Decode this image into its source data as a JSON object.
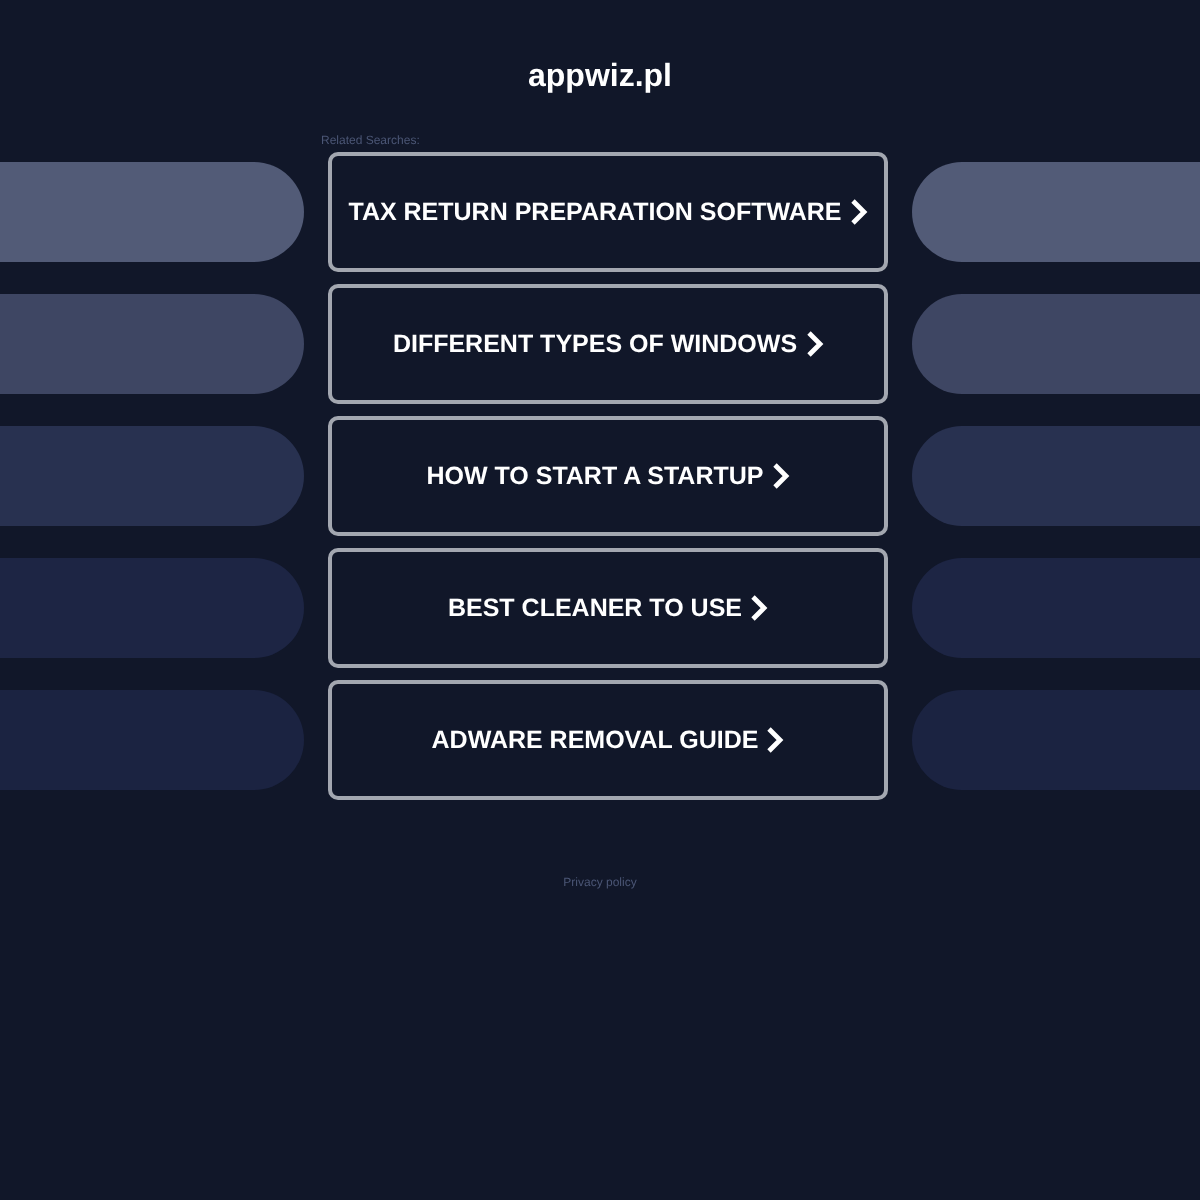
{
  "site_title": "appwiz.pl",
  "related_label": "Related Searches:",
  "links": [
    {
      "label": "TAX RETURN PREPARATION SOFTWARE"
    },
    {
      "label": "DIFFERENT TYPES OF WINDOWS"
    },
    {
      "label": "HOW TO START A STARTUP"
    },
    {
      "label": "BEST CLEANER TO USE"
    },
    {
      "label": "ADWARE REMOVAL GUIDE"
    }
  ],
  "footer": {
    "privacy_link": "Privacy policy"
  }
}
